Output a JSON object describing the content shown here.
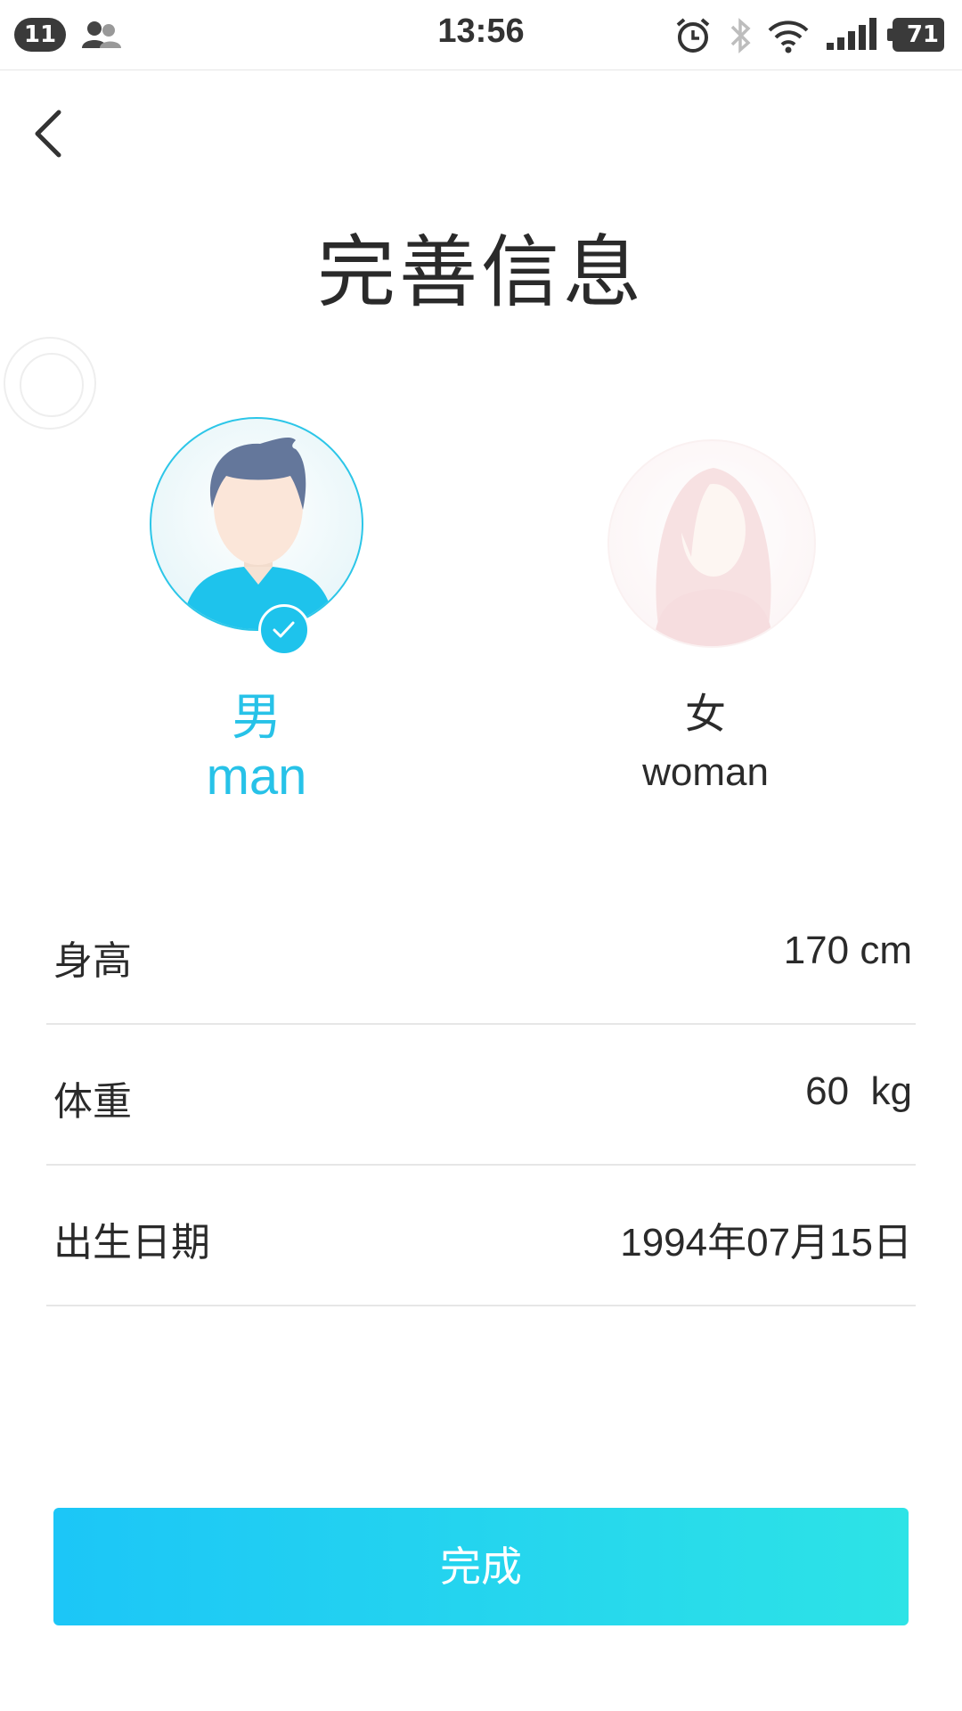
{
  "status_bar": {
    "notification_count": "11",
    "time": "13:56",
    "battery": "71"
  },
  "title": "完善信息",
  "gender": {
    "selected": "man",
    "man": {
      "cn": "男",
      "en": "man"
    },
    "woman": {
      "cn": "女",
      "en": "woman"
    }
  },
  "form": {
    "height": {
      "label": "身高",
      "value": "170 cm"
    },
    "weight": {
      "label": "体重",
      "value": "60  kg"
    },
    "birth": {
      "label": "出生日期",
      "value": "1994年07月15日"
    }
  },
  "done_button": {
    "label": "完成"
  },
  "colors": {
    "accent": "#27c2e8",
    "button_gradient_start": "#1cc6f7",
    "button_gradient_end": "#2de3e6",
    "text": "#2a2a2a",
    "divider": "#e6e6e6"
  }
}
